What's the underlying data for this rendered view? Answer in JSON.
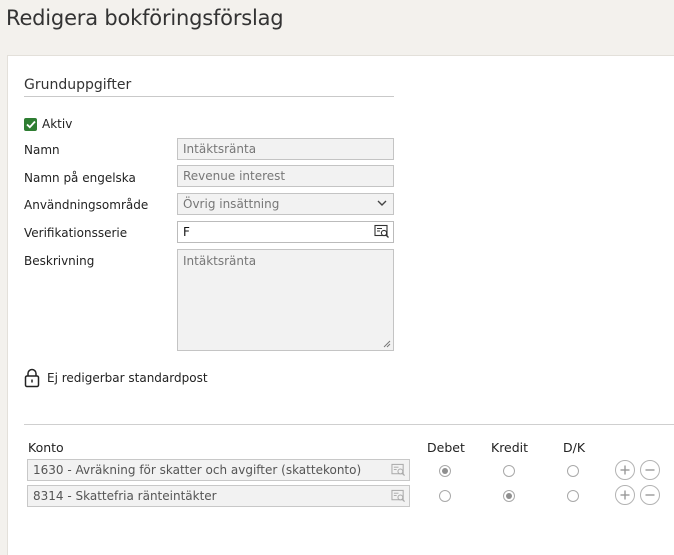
{
  "page": {
    "title": "Redigera bokföringsförslag"
  },
  "basic": {
    "section_title": "Grunduppgifter",
    "active_label": "Aktiv",
    "active_checked": true,
    "name_label": "Namn",
    "name_value": "Intäktsränta",
    "name_en_label": "Namn på engelska",
    "name_en_value": "Revenue interest",
    "usage_label": "Användningsområde",
    "usage_value": "Övrig insättning",
    "series_label": "Verifikationsserie",
    "series_value": "F",
    "desc_label": "Beskrivning",
    "desc_value": "Intäktsränta",
    "lock_text": "Ej redigerbar standardpost"
  },
  "table": {
    "headers": {
      "account": "Konto",
      "debit": "Debet",
      "credit": "Kredit",
      "dk": "D/K"
    },
    "rows": [
      {
        "account": "1630 - Avräkning för skatter och avgifter (skattekonto)",
        "selected": "debit"
      },
      {
        "account": "8314 - Skattefria ränteintäkter",
        "selected": "credit"
      }
    ]
  },
  "icons": {
    "checkbox": "check-icon",
    "dropdown": "chevron-down-icon",
    "lookup": "lookup-icon",
    "lock": "lock-icon",
    "add": "plus-circle-icon",
    "remove": "minus-circle-icon"
  },
  "colors": {
    "accent": "#2e7d32",
    "page_bg": "#f3f1ed",
    "panel_bg": "#ffffff"
  }
}
